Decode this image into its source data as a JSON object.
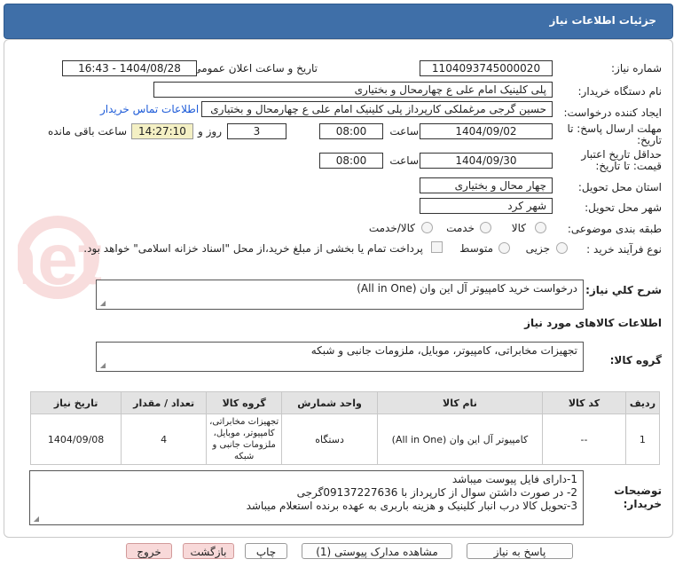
{
  "header": {
    "title": "جزئیات اطلاعات نیاز"
  },
  "fields": {
    "need_number_label": "شماره نیاز:",
    "need_number": "1104093745000020",
    "announce_label": "تاریخ و ساعت اعلان عمومی:",
    "announce_value": "1404/08/28 - 16:43",
    "buyer_org_label": "نام دستگاه خریدار:",
    "buyer_org": "پلی کلینیک امام علی  ع  چهارمحال و بختیاری",
    "creator_label": "ایجاد کننده درخواست:",
    "creator": "حسین گرجی مرغملکی کارپرداز پلی کلینیک امام علی  ع  چهارمحال و بختیاری",
    "contact_link": "اطلاعات تماس خریدار",
    "deadline_label": "مهلت ارسال پاسخ: تا",
    "deadline_label2": "تاریخ:",
    "deadline_date": "1404/09/02",
    "time_label": "ساعت",
    "deadline_time": "08:00",
    "days_value": "3",
    "days_label": "روز و",
    "remaining_time": "14:27:10",
    "remaining_label": "ساعت باقی مانده",
    "validity_label": "حداقل تاریخ اعتبار",
    "validity_label2": "قیمت: تا تاریخ:",
    "validity_date": "1404/09/30",
    "validity_time": "08:00",
    "province_label": "استان محل تحویل:",
    "province": "چهار محال و بختیاری",
    "city_label": "شهر محل تحویل:",
    "city": "شهر کرد",
    "category_label": "طبقه بندی موضوعی:",
    "cat_goods": "کالا",
    "cat_service": "خدمت",
    "cat_goods_service": "کالا/خدمت",
    "process_label": "نوع فرآیند خرید :",
    "proc_minor": "جزیی",
    "proc_medium": "متوسط",
    "payment_note": "پرداخت تمام یا بخشی از مبلغ خرید،از محل \"اسناد خزانه اسلامی\" خواهد بود."
  },
  "description": {
    "label": "شرح كلي نياز:",
    "value": "درخواست خرید  کامپیوتر آل این وان (All in One)"
  },
  "goods_info_title": "اطلاعات کالاهای مورد نیاز",
  "goods_group": {
    "label": "گروه کالا:",
    "value": "تجهیزات مخابراتی، کامپیوتر، موبایل، ملزومات جانبی و شبکه"
  },
  "table": {
    "headers": [
      "ردیف",
      "کد کالا",
      "نام کالا",
      "واحد شمارش",
      "گروه کالا",
      "تعداد / مقدار",
      "تاریخ نیاز"
    ],
    "rows": [
      {
        "row": "1",
        "code": "--",
        "name": "کامپیوتر آل این وان (All in One)",
        "unit": "دستگاه",
        "group": "تجهیزات مخابراتی، کامپیوتر، موبایل، ملزومات جانبی و شبکه",
        "qty": "4",
        "date": "1404/09/08"
      }
    ]
  },
  "notes": {
    "label": "توضیحات",
    "label2": "خریدار:",
    "line1": "1-دارای فایل پیوست میباشد",
    "line2": "2- در صورت داشتن سوال  از کارپرداز با 09137227636گرجی",
    "line3": "3-تحویل کالا درب انبار کلینیک و هزینه باربری به عهده برنده استعلام میباشد"
  },
  "buttons": {
    "reply": "پاسخ به نیاز",
    "docs": "مشاهده مدارک پیوستی (1)",
    "print": "چاپ",
    "back": "بازگشت",
    "exit": "خروج"
  },
  "watermark": "AriaTender.net"
}
